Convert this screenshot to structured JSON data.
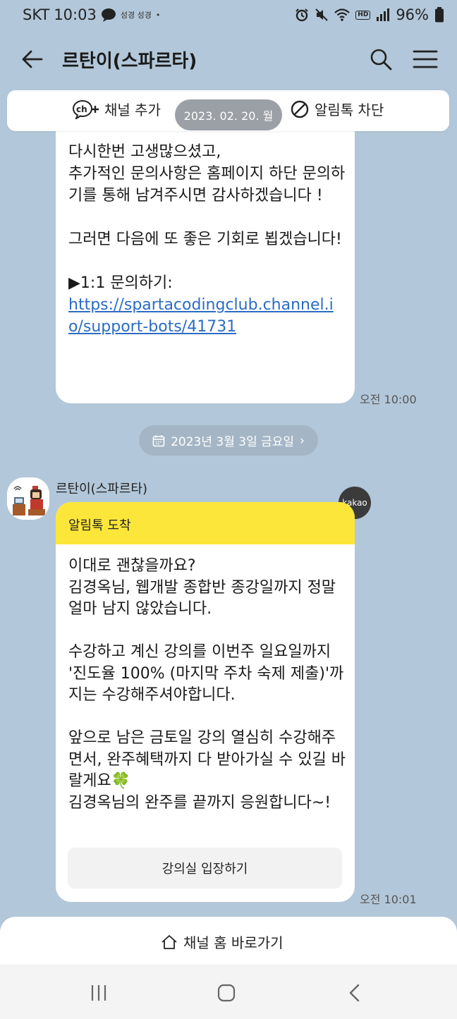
{
  "status_bar": {
    "carrier": "SKT",
    "time": "10:03",
    "notify_text": "성경 성경",
    "dot": "•",
    "battery": "96%",
    "volte": "HD"
  },
  "app_bar": {
    "title": "르탄이(스파르타)"
  },
  "channel_bar": {
    "add_channel": "채널 추가",
    "block_alimtalk": "알림톡 차단",
    "date_pill": "2023. 02. 20. 월"
  },
  "messages": [
    {
      "text": "다시한번 고생많으셨고,\n추가적인 문의사항은 홈페이지 하단 문의하기를 통해 남겨주시면 감사하겠습니다 !\n\n그러면 다음에 또 좋은 기회로 뵙겠습니다!\n\n▶1:1 문의하기:",
      "link": "https://spartacodingclub.channel.io/support-bots/41731",
      "time": "오전 10:00"
    }
  ],
  "day_divider": "2023년 3월 3일 금요일",
  "day_divider_arrow": "›",
  "sender_name": "르탄이(스파르타)",
  "kakao_badge": "kakao",
  "alimtalk": {
    "header": "알림톡 도착",
    "body": "이대로 괜찮을까요?\n김경옥님, 웹개발 종합반 종강일까지 정말 얼마 남지 않았습니다.\n\n수강하고 계신 강의를 이번주 일요일까지 '진도율 100% (마지막 주차 숙제 제출)'까지는 수강해주셔야합니다.\n\n앞으로 남은 금토일 강의 열심히 수강해주면서, 완주혜택까지 다 받아가실 수 있길 바랄게요🍀\n김경옥님의 완주를 끝까지 응원합니다~!",
    "button": "강의실 입장하기",
    "time": "오전 10:01",
    "header_color": "#fce63a"
  },
  "channel_home": "채널 홈 바로가기",
  "colors": {
    "background": "#b2c7d9",
    "link": "#2b6cc4",
    "kakao_yellow": "#fce63a"
  }
}
